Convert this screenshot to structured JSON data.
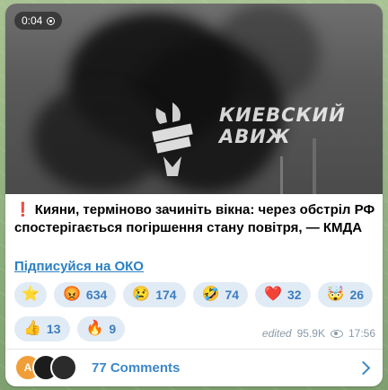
{
  "video": {
    "duration": "0:04",
    "watermark_text": "КИЕВСКИЙ\nАВИЖ",
    "icon": "play-circle-icon"
  },
  "post": {
    "caption_emoji": "❗",
    "caption_text": "Кияни, терміново зачиніть вікна: через обстріл РФ спостерігається погіршення стану повітря, — КМДА",
    "subscribe_link": "Підписуйся на ОКО"
  },
  "reactions": [
    {
      "emoji": "⭐",
      "count": ""
    },
    {
      "emoji": "😡",
      "count": "634"
    },
    {
      "emoji": "😢",
      "count": "174"
    },
    {
      "emoji": "🤣",
      "count": "74"
    },
    {
      "emoji": "❤️",
      "count": "32"
    },
    {
      "emoji": "🤯",
      "count": "26"
    },
    {
      "emoji": "👍",
      "count": "13"
    },
    {
      "emoji": "🔥",
      "count": "9"
    }
  ],
  "meta": {
    "edited": "edited",
    "views": "95.9K",
    "time": "17:56"
  },
  "comments": {
    "label": "77 Comments",
    "avatar_letter": "A"
  },
  "colors": {
    "accent": "#3d87c9",
    "reaction_bg": "#e1ebf5"
  }
}
